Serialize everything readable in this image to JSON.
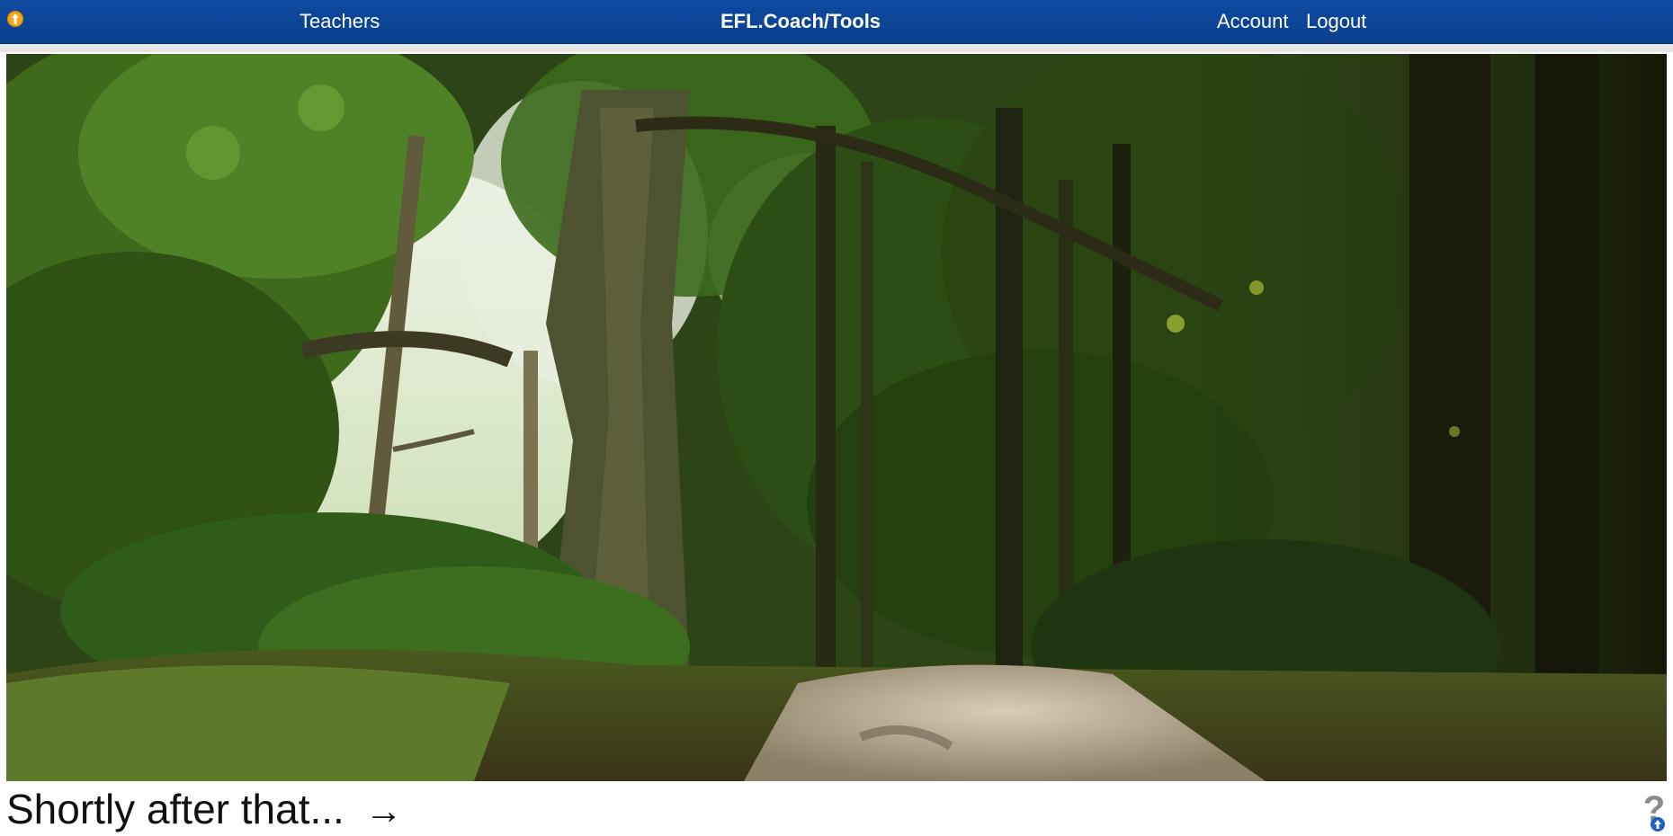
{
  "nav": {
    "teachers": "Teachers",
    "brand": "EFL.Coach/Tools",
    "account": "Account",
    "logout": "Logout"
  },
  "icons": {
    "top_left_badge": "info-up-arrow-icon",
    "arrow": "right-arrow-icon",
    "help": "question-mark-icon",
    "help_badge": "up-arrow-badge-icon"
  },
  "story": {
    "text": "Shortly after that...",
    "arrow": "→"
  },
  "help": {
    "symbol": "?"
  },
  "colors": {
    "navbar": "#0c459a",
    "badge": "#f2a51a",
    "help_badge": "#1d5fc4"
  }
}
